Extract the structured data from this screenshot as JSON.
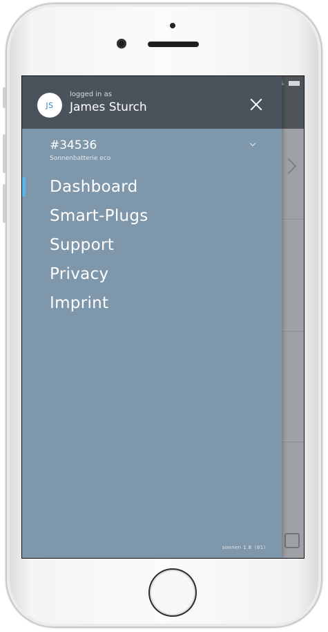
{
  "header": {
    "logged_in_label": "logged in as",
    "user_name": "James Sturch",
    "avatar_initials": "JS"
  },
  "device": {
    "id": "#34536",
    "model": "Sonnenbatterie eco"
  },
  "nav": {
    "items": [
      {
        "label": "Dashboard",
        "active": true
      },
      {
        "label": "Smart-Plugs",
        "active": false
      },
      {
        "label": "Support",
        "active": false
      },
      {
        "label": "Privacy",
        "active": false
      },
      {
        "label": "Imprint",
        "active": false
      }
    ]
  },
  "footer": {
    "version": "sonnen 1.8（81）"
  },
  "icons": {
    "close": "close-icon",
    "chevron": "chevron-down-icon"
  },
  "colors": {
    "drawer_bg": "#7f97ab",
    "header_bg": "#4a535c",
    "accent": "#5fb4e6",
    "avatar_text": "#2f86c8"
  }
}
